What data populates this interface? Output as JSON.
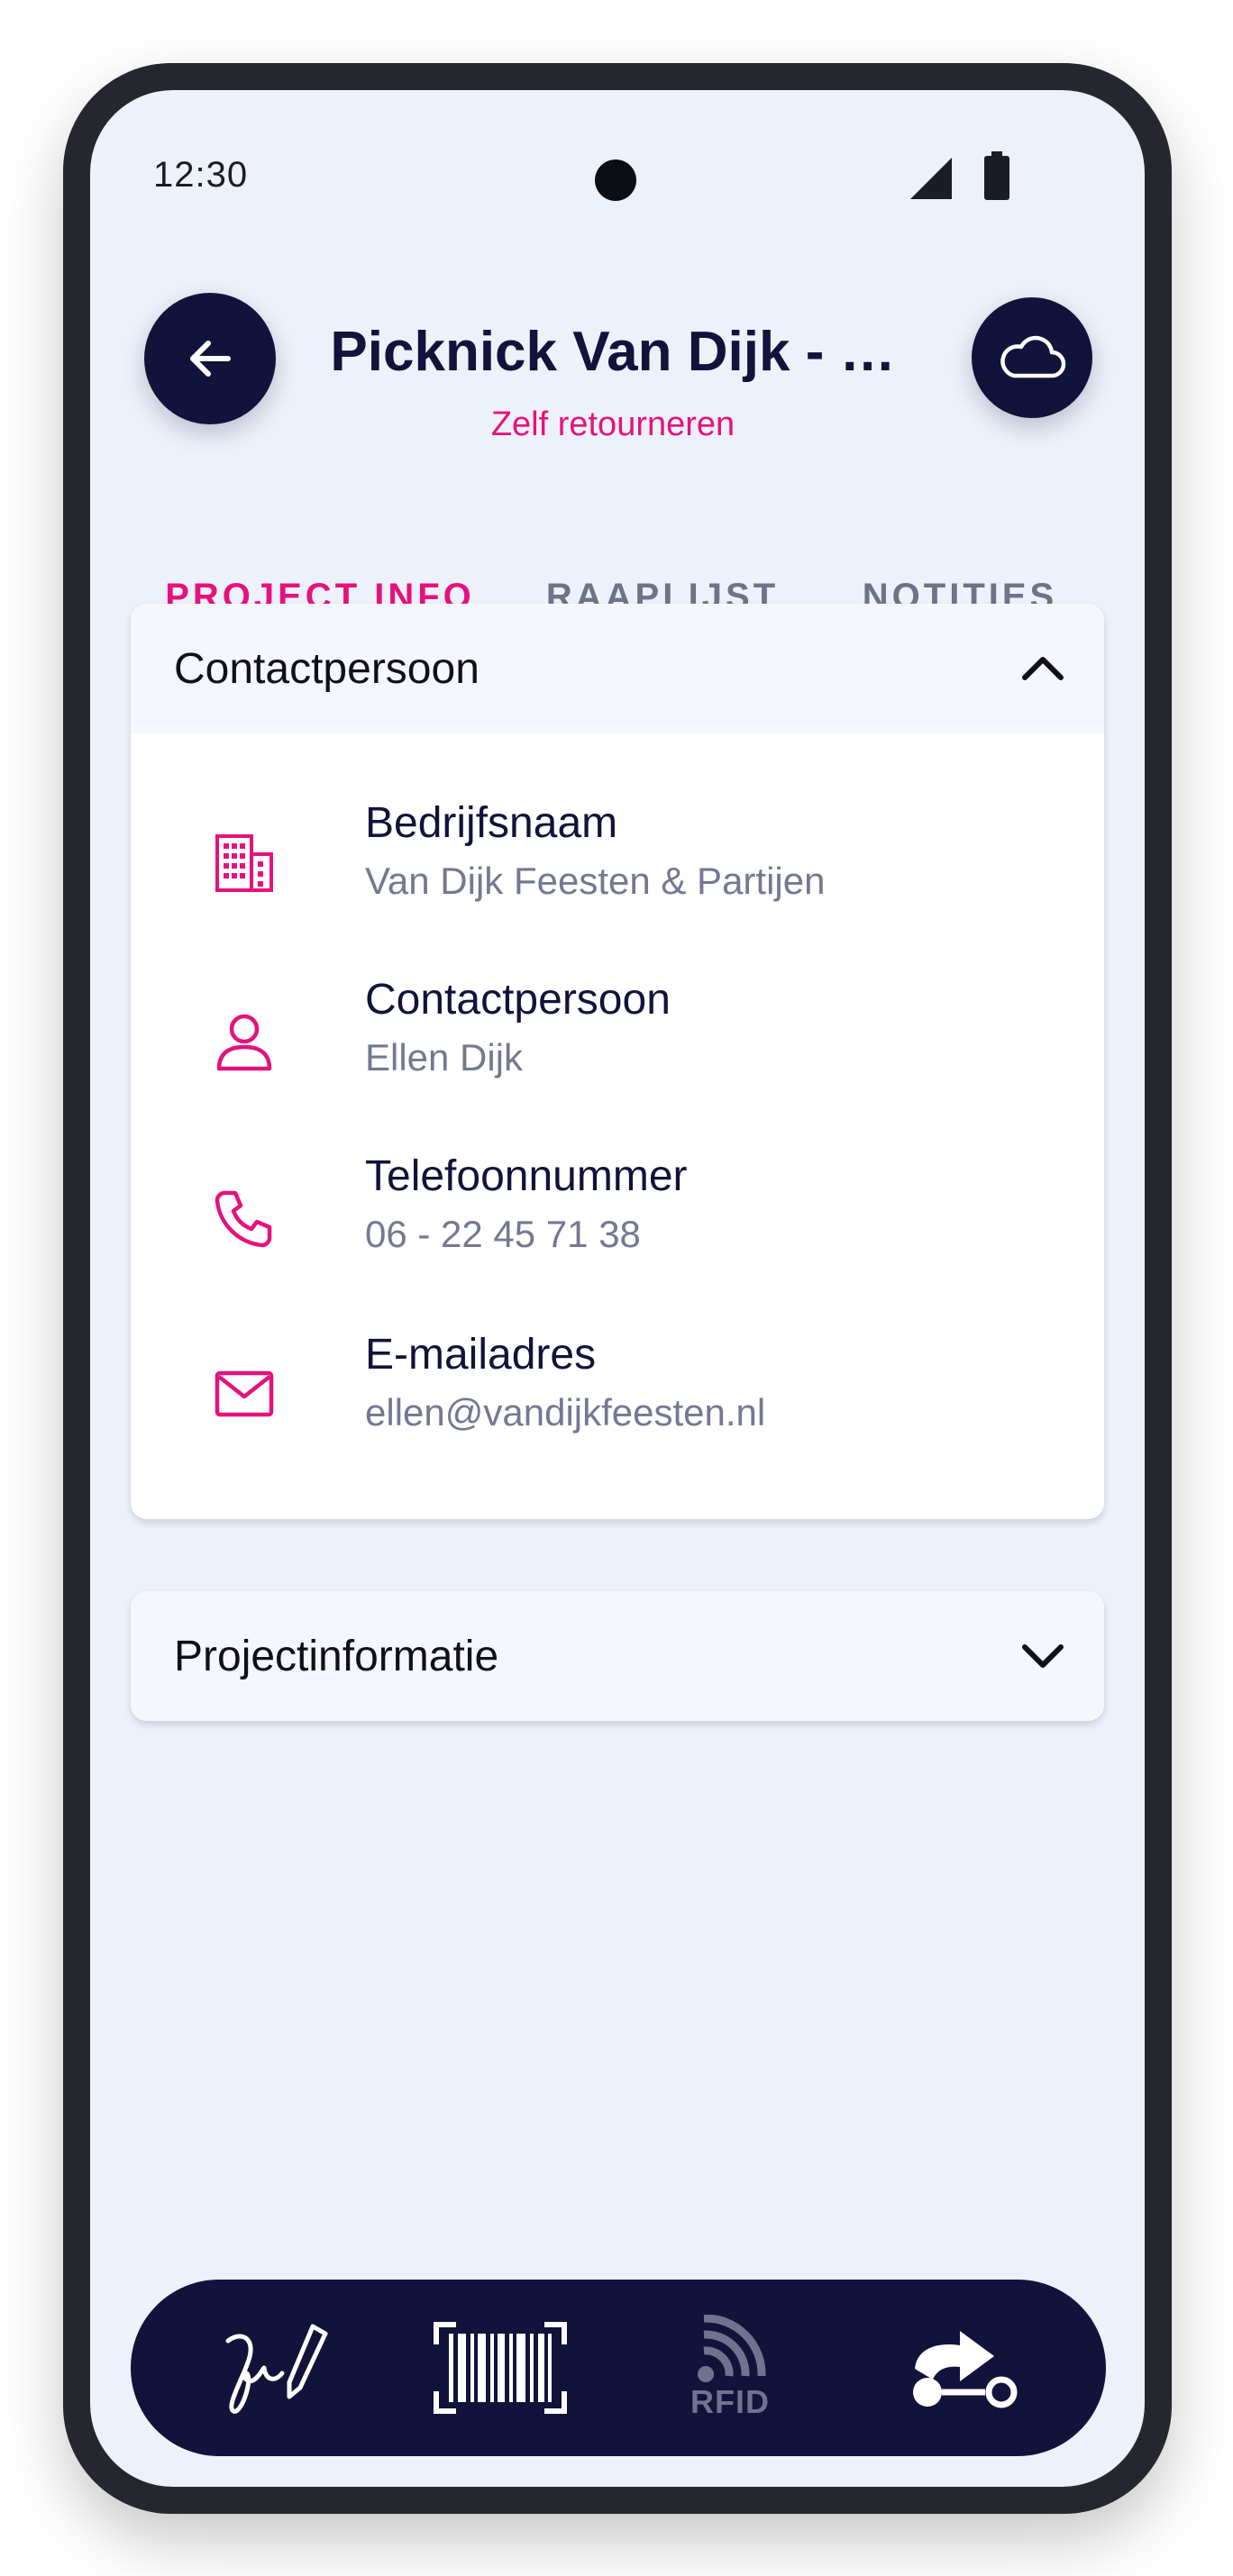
{
  "status_bar": {
    "time": "12:30"
  },
  "header": {
    "title": "Picknick Van Dijk - …",
    "subtitle": "Zelf retourneren",
    "back_icon": "arrow-left-icon",
    "cloud_icon": "cloud-icon"
  },
  "tabs": [
    {
      "label": "PROJECT INFO",
      "active": true
    },
    {
      "label": "RAAPLIJST",
      "active": false
    },
    {
      "label": "NOTITIES",
      "active": false
    }
  ],
  "contact_section": {
    "title": "Contactpersoon",
    "expanded": true,
    "rows": [
      {
        "icon": "building-icon",
        "label": "Bedrijfsnaam",
        "value": "Van Dijk Feesten & Partijen"
      },
      {
        "icon": "person-icon",
        "label": "Contactpersoon",
        "value": "Ellen Dijk"
      },
      {
        "icon": "phone-icon",
        "label": "Telefoonnummer",
        "value": "06 - 22 45 71 38"
      },
      {
        "icon": "mail-icon",
        "label": "E-mailadres",
        "value": "ellen@vandijkfeesten.nl"
      }
    ]
  },
  "project_section": {
    "title": "Projectinformatie",
    "expanded": false
  },
  "bottom_nav": {
    "items": [
      {
        "icon": "signature-icon"
      },
      {
        "icon": "barcode-icon"
      },
      {
        "icon": "rfid-icon",
        "label": "RFID",
        "disabled": true
      },
      {
        "icon": "route-icon"
      }
    ]
  },
  "colors": {
    "accent": "#e5127d",
    "navy": "#12133a",
    "background": "#edf1fa",
    "muted_text": "#757891"
  }
}
